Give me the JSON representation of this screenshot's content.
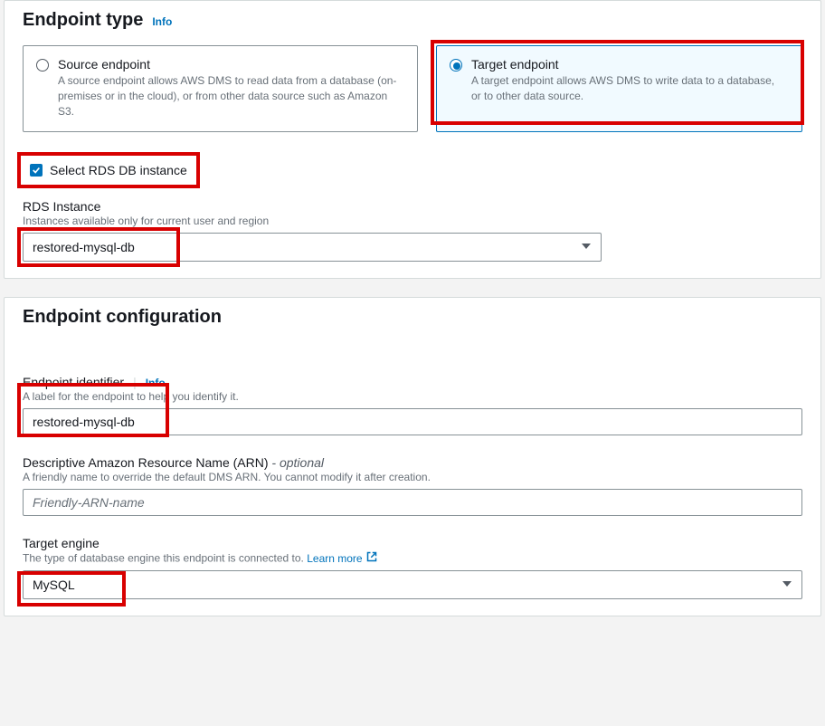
{
  "endpointType": {
    "title": "Endpoint type",
    "infoLabel": "Info",
    "source": {
      "title": "Source endpoint",
      "desc": "A source endpoint allows AWS DMS to read data from a database (on-premises or in the cloud), or from other data source such as Amazon S3."
    },
    "target": {
      "title": "Target endpoint",
      "desc": "A target endpoint allows AWS DMS to write data to a database, or to other data source."
    },
    "selectRdsCheckbox": "Select RDS DB instance",
    "rdsInstance": {
      "label": "RDS Instance",
      "help": "Instances available only for current user and region",
      "value": "restored-mysql-db"
    }
  },
  "endpointConfig": {
    "title": "Endpoint configuration",
    "identifier": {
      "label": "Endpoint identifier",
      "infoLabel": "Info",
      "help": "A label for the endpoint to help you identify it.",
      "value": "restored-mysql-db"
    },
    "arn": {
      "label": "Descriptive Amazon Resource Name (ARN)",
      "optional": "- optional",
      "help": "A friendly name to override the default DMS ARN. You cannot modify it after creation.",
      "placeholder": "Friendly-ARN-name"
    },
    "targetEngine": {
      "label": "Target engine",
      "help": "The type of database engine this endpoint is connected to.",
      "learnMore": "Learn more",
      "value": "MySQL"
    }
  }
}
